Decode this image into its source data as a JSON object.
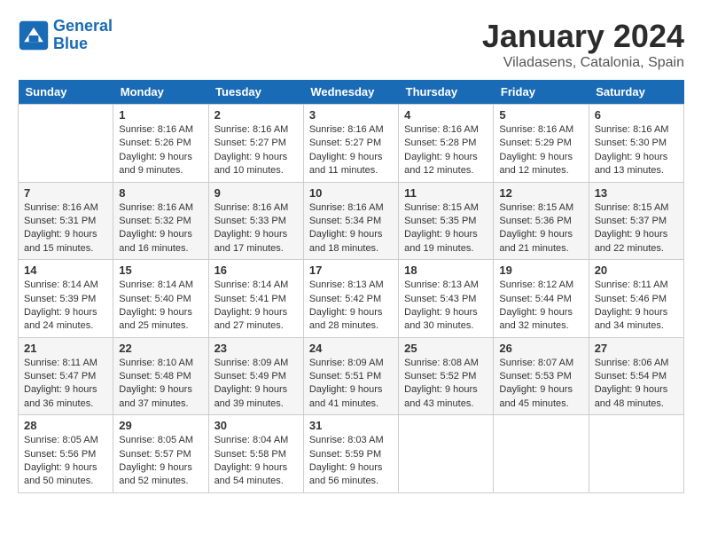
{
  "header": {
    "logo_line1": "General",
    "logo_line2": "Blue",
    "month_title": "January 2024",
    "location": "Viladasens, Catalonia, Spain"
  },
  "days_of_week": [
    "Sunday",
    "Monday",
    "Tuesday",
    "Wednesday",
    "Thursday",
    "Friday",
    "Saturday"
  ],
  "weeks": [
    [
      {
        "day": "",
        "data": ""
      },
      {
        "day": "1",
        "data": "Sunrise: 8:16 AM\nSunset: 5:26 PM\nDaylight: 9 hours\nand 9 minutes."
      },
      {
        "day": "2",
        "data": "Sunrise: 8:16 AM\nSunset: 5:27 PM\nDaylight: 9 hours\nand 10 minutes."
      },
      {
        "day": "3",
        "data": "Sunrise: 8:16 AM\nSunset: 5:27 PM\nDaylight: 9 hours\nand 11 minutes."
      },
      {
        "day": "4",
        "data": "Sunrise: 8:16 AM\nSunset: 5:28 PM\nDaylight: 9 hours\nand 12 minutes."
      },
      {
        "day": "5",
        "data": "Sunrise: 8:16 AM\nSunset: 5:29 PM\nDaylight: 9 hours\nand 12 minutes."
      },
      {
        "day": "6",
        "data": "Sunrise: 8:16 AM\nSunset: 5:30 PM\nDaylight: 9 hours\nand 13 minutes."
      }
    ],
    [
      {
        "day": "7",
        "data": "Sunrise: 8:16 AM\nSunset: 5:31 PM\nDaylight: 9 hours\nand 15 minutes."
      },
      {
        "day": "8",
        "data": "Sunrise: 8:16 AM\nSunset: 5:32 PM\nDaylight: 9 hours\nand 16 minutes."
      },
      {
        "day": "9",
        "data": "Sunrise: 8:16 AM\nSunset: 5:33 PM\nDaylight: 9 hours\nand 17 minutes."
      },
      {
        "day": "10",
        "data": "Sunrise: 8:16 AM\nSunset: 5:34 PM\nDaylight: 9 hours\nand 18 minutes."
      },
      {
        "day": "11",
        "data": "Sunrise: 8:15 AM\nSunset: 5:35 PM\nDaylight: 9 hours\nand 19 minutes."
      },
      {
        "day": "12",
        "data": "Sunrise: 8:15 AM\nSunset: 5:36 PM\nDaylight: 9 hours\nand 21 minutes."
      },
      {
        "day": "13",
        "data": "Sunrise: 8:15 AM\nSunset: 5:37 PM\nDaylight: 9 hours\nand 22 minutes."
      }
    ],
    [
      {
        "day": "14",
        "data": "Sunrise: 8:14 AM\nSunset: 5:39 PM\nDaylight: 9 hours\nand 24 minutes."
      },
      {
        "day": "15",
        "data": "Sunrise: 8:14 AM\nSunset: 5:40 PM\nDaylight: 9 hours\nand 25 minutes."
      },
      {
        "day": "16",
        "data": "Sunrise: 8:14 AM\nSunset: 5:41 PM\nDaylight: 9 hours\nand 27 minutes."
      },
      {
        "day": "17",
        "data": "Sunrise: 8:13 AM\nSunset: 5:42 PM\nDaylight: 9 hours\nand 28 minutes."
      },
      {
        "day": "18",
        "data": "Sunrise: 8:13 AM\nSunset: 5:43 PM\nDaylight: 9 hours\nand 30 minutes."
      },
      {
        "day": "19",
        "data": "Sunrise: 8:12 AM\nSunset: 5:44 PM\nDaylight: 9 hours\nand 32 minutes."
      },
      {
        "day": "20",
        "data": "Sunrise: 8:11 AM\nSunset: 5:46 PM\nDaylight: 9 hours\nand 34 minutes."
      }
    ],
    [
      {
        "day": "21",
        "data": "Sunrise: 8:11 AM\nSunset: 5:47 PM\nDaylight: 9 hours\nand 36 minutes."
      },
      {
        "day": "22",
        "data": "Sunrise: 8:10 AM\nSunset: 5:48 PM\nDaylight: 9 hours\nand 37 minutes."
      },
      {
        "day": "23",
        "data": "Sunrise: 8:09 AM\nSunset: 5:49 PM\nDaylight: 9 hours\nand 39 minutes."
      },
      {
        "day": "24",
        "data": "Sunrise: 8:09 AM\nSunset: 5:51 PM\nDaylight: 9 hours\nand 41 minutes."
      },
      {
        "day": "25",
        "data": "Sunrise: 8:08 AM\nSunset: 5:52 PM\nDaylight: 9 hours\nand 43 minutes."
      },
      {
        "day": "26",
        "data": "Sunrise: 8:07 AM\nSunset: 5:53 PM\nDaylight: 9 hours\nand 45 minutes."
      },
      {
        "day": "27",
        "data": "Sunrise: 8:06 AM\nSunset: 5:54 PM\nDaylight: 9 hours\nand 48 minutes."
      }
    ],
    [
      {
        "day": "28",
        "data": "Sunrise: 8:05 AM\nSunset: 5:56 PM\nDaylight: 9 hours\nand 50 minutes."
      },
      {
        "day": "29",
        "data": "Sunrise: 8:05 AM\nSunset: 5:57 PM\nDaylight: 9 hours\nand 52 minutes."
      },
      {
        "day": "30",
        "data": "Sunrise: 8:04 AM\nSunset: 5:58 PM\nDaylight: 9 hours\nand 54 minutes."
      },
      {
        "day": "31",
        "data": "Sunrise: 8:03 AM\nSunset: 5:59 PM\nDaylight: 9 hours\nand 56 minutes."
      },
      {
        "day": "",
        "data": ""
      },
      {
        "day": "",
        "data": ""
      },
      {
        "day": "",
        "data": ""
      }
    ]
  ]
}
